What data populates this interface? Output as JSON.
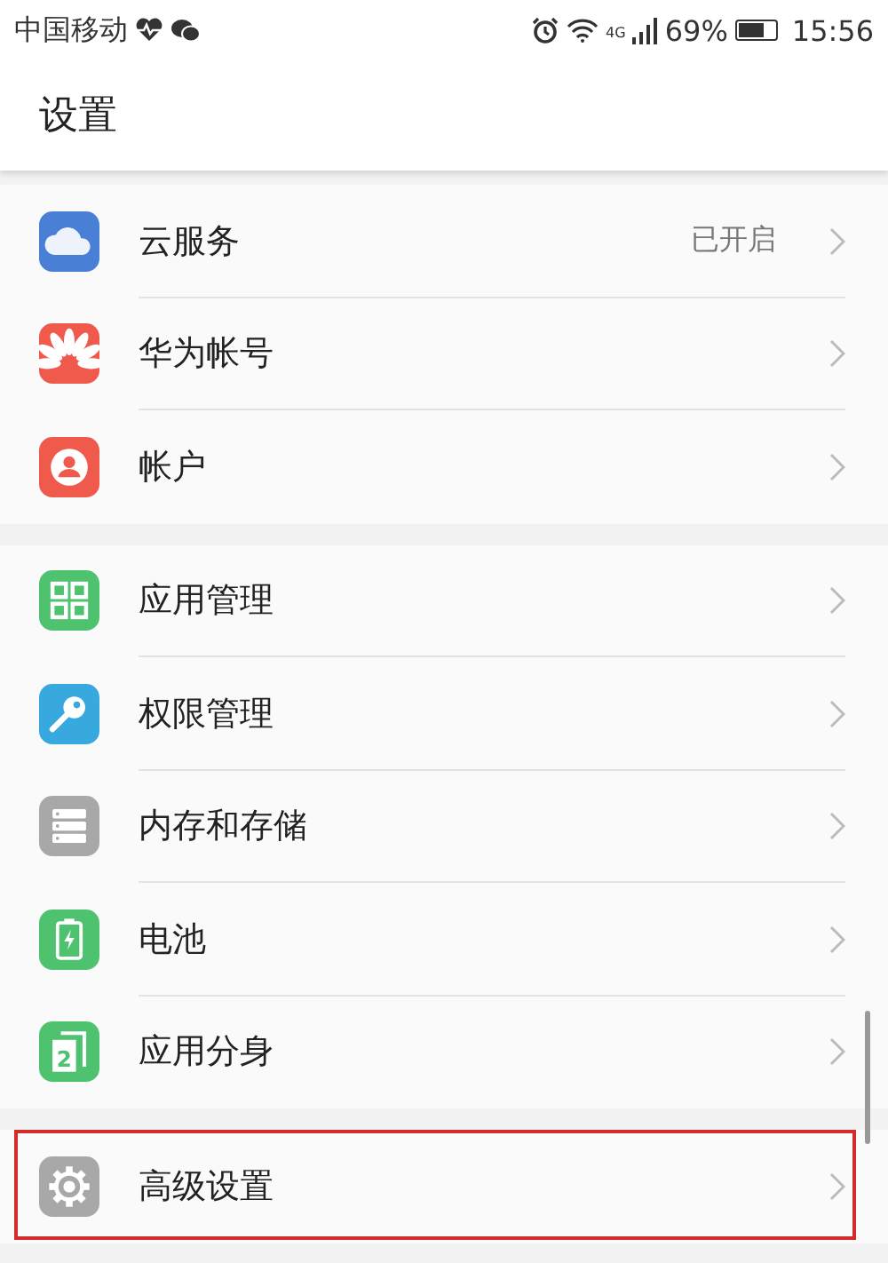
{
  "status_bar": {
    "carrier": "中国移动",
    "network": "4G",
    "battery": "69%",
    "time": "15:56"
  },
  "header": {
    "title": "设置"
  },
  "groups": [
    {
      "items": [
        {
          "label": "云服务",
          "kind": "cloud",
          "color": "#4a7fd6",
          "value": "已开启",
          "highlighted": false
        },
        {
          "label": "华为帐号",
          "kind": "petals",
          "color": "#ef5a4c",
          "highlighted": false
        },
        {
          "label": "帐户",
          "kind": "person",
          "color": "#ef5a4c",
          "highlighted": false
        }
      ]
    },
    {
      "items": [
        {
          "label": "应用管理",
          "kind": "grid",
          "color": "#4fc270",
          "highlighted": false
        },
        {
          "label": "权限管理",
          "kind": "key",
          "color": "#38a9df",
          "highlighted": false
        },
        {
          "label": "内存和存储",
          "kind": "storage",
          "color": "#a8a8a8",
          "highlighted": false
        },
        {
          "label": "电池",
          "kind": "battery",
          "color": "#4fc270",
          "highlighted": false
        },
        {
          "label": "应用分身",
          "kind": "clone",
          "color": "#4fc270",
          "icon_text": "2",
          "highlighted": false
        }
      ]
    },
    {
      "items": [
        {
          "label": "高级设置",
          "kind": "gear",
          "color": "#a8a8a8",
          "highlighted": true
        }
      ]
    }
  ]
}
